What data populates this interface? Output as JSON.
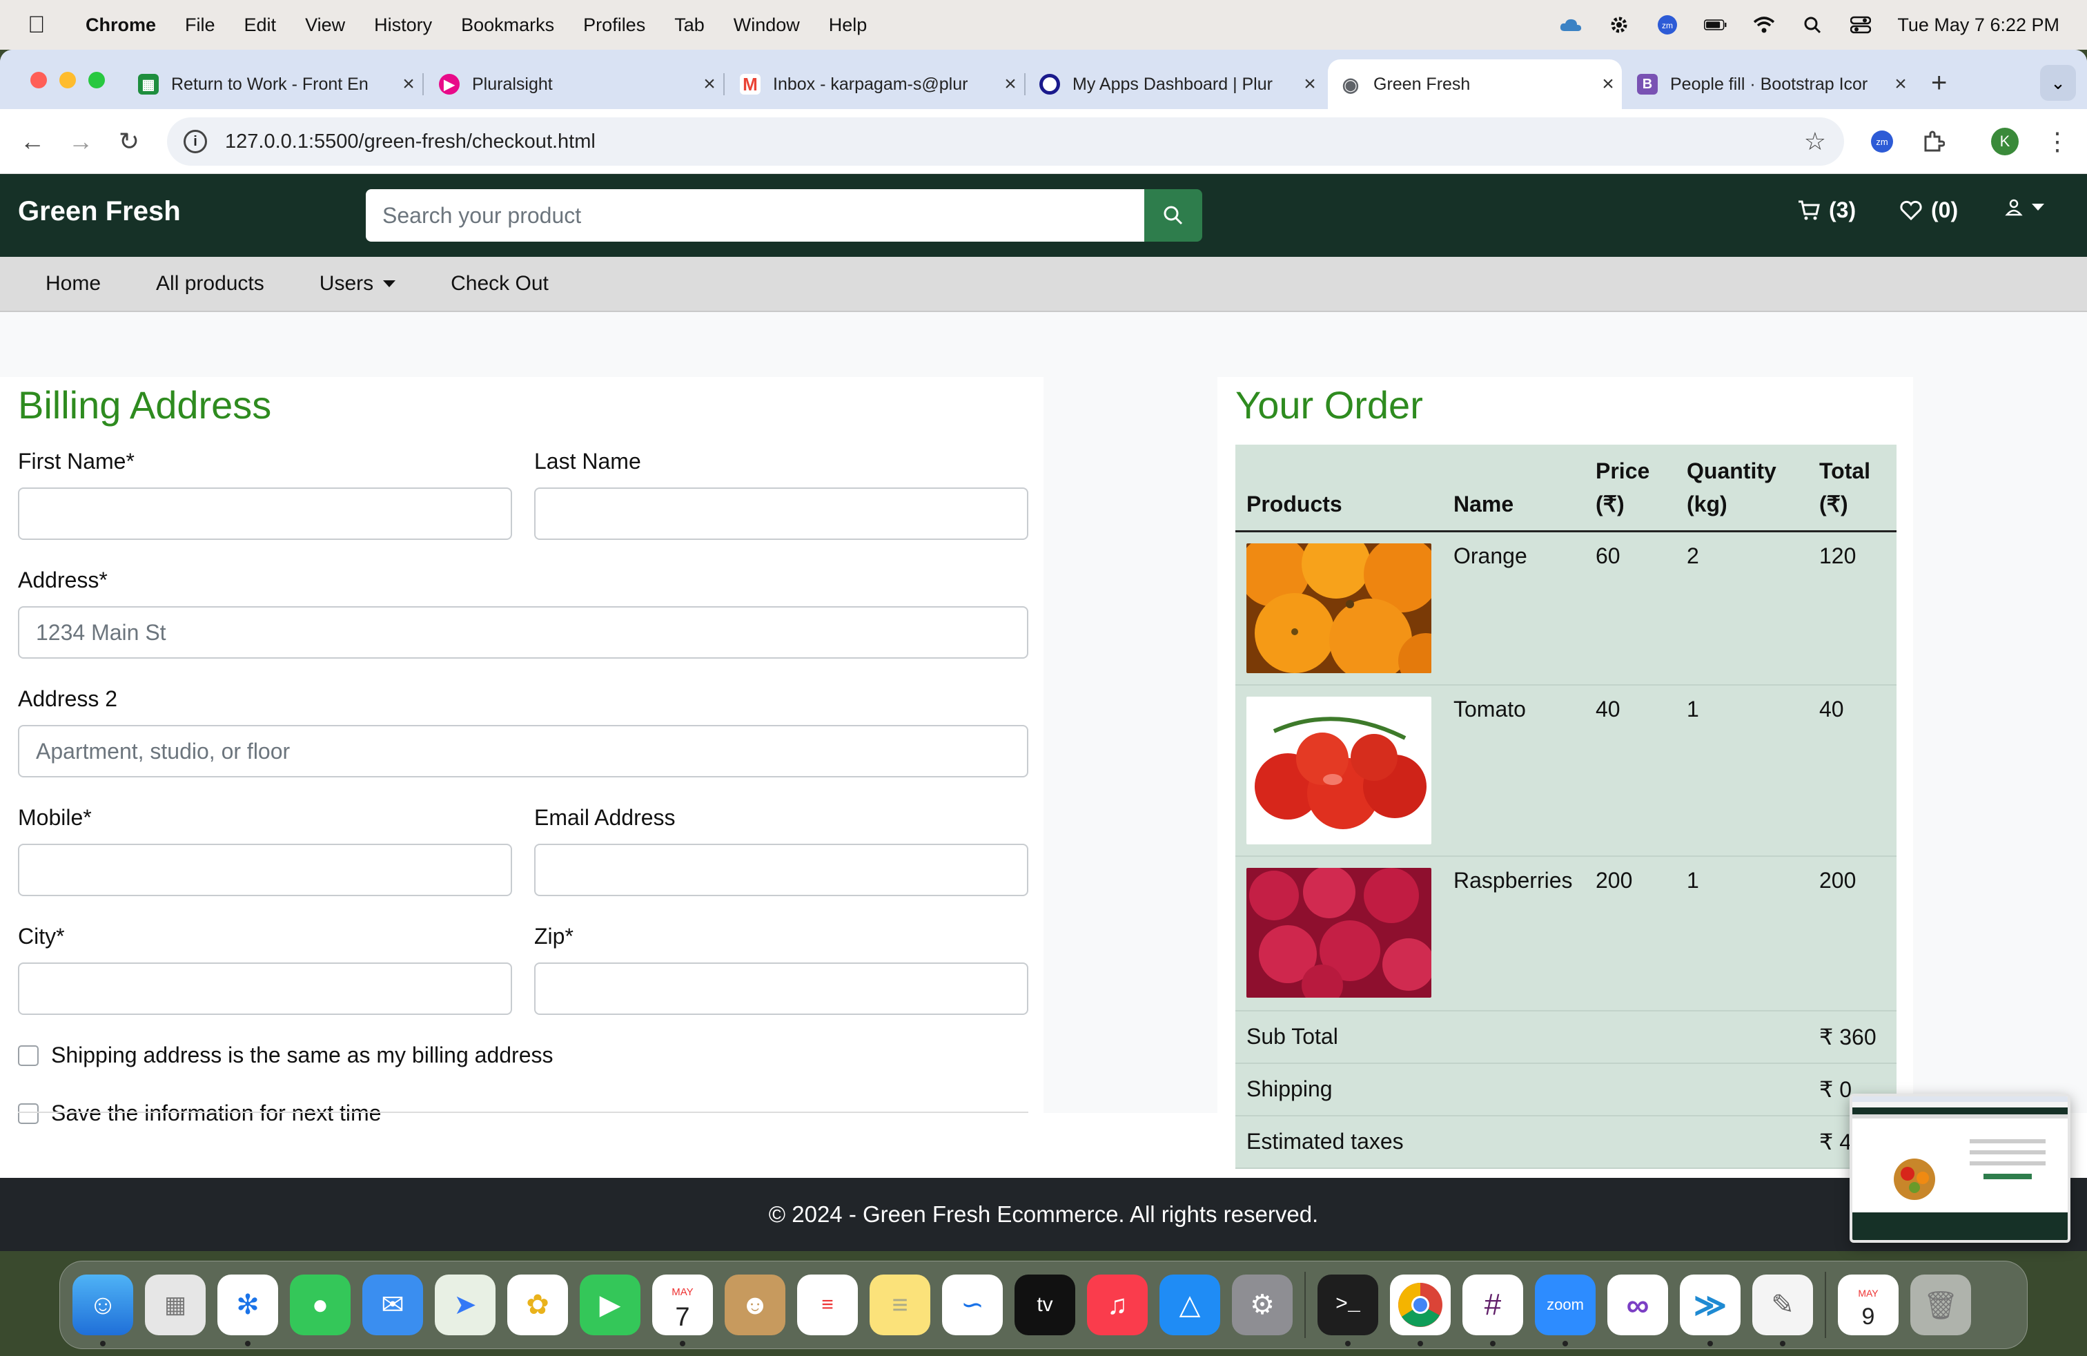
{
  "menubar": {
    "app": "Chrome",
    "items": [
      "File",
      "Edit",
      "View",
      "History",
      "Bookmarks",
      "Profiles",
      "Tab",
      "Window",
      "Help"
    ],
    "clock": "Tue May 7  6:22 PM"
  },
  "browser": {
    "tabs": [
      {
        "label": "Return to Work - Front En",
        "icon": "sheets-icon",
        "color": "#1e8e3e"
      },
      {
        "label": "Pluralsight",
        "icon": "pluralsight-icon",
        "color": "#e80a89"
      },
      {
        "label": "Inbox - karpagam-s@plur",
        "icon": "gmail-icon",
        "color": "#ea4335"
      },
      {
        "label": "My Apps Dashboard | Plur",
        "icon": "okta-icon",
        "color": "#1a1a8c"
      },
      {
        "label": "Green Fresh",
        "icon": "globe-icon",
        "color": "#5f6368"
      },
      {
        "label": "People fill · Bootstrap Icor",
        "icon": "bootstrap-icon",
        "color": "#7952b3"
      }
    ],
    "url": "127.0.0.1:5500/green-fresh/checkout.html",
    "profile_initial": "K"
  },
  "site": {
    "brand": "Green Fresh",
    "search_placeholder": "Search your product",
    "cart_count": "(3)",
    "wishlist_count": "(0)",
    "nav": [
      "Home",
      "All products",
      "Users",
      "Check Out"
    ],
    "billing": {
      "title": "Billing Address",
      "first_name_label": "First Name*",
      "last_name_label": "Last Name",
      "address_label": "Address*",
      "address_placeholder": "1234 Main St",
      "address2_label": "Address 2",
      "address2_placeholder": "Apartment, studio, or floor",
      "mobile_label": "Mobile*",
      "email_label": "Email Address",
      "city_label": "City*",
      "zip_label": "Zip*",
      "same_address_label": "Shipping address is the same as my billing address",
      "save_info_label": "Save the information for next time"
    },
    "order": {
      "title": "Your Order",
      "headers": [
        "Products",
        "Name",
        "Price (₹)",
        "Quantity (kg)",
        "Total (₹)"
      ],
      "items": [
        {
          "name": "Orange",
          "price": "60",
          "qty": "2",
          "total": "120"
        },
        {
          "name": "Tomato",
          "price": "40",
          "qty": "1",
          "total": "40"
        },
        {
          "name": "Raspberries",
          "price": "200",
          "qty": "1",
          "total": "200"
        }
      ],
      "summary": [
        {
          "label": "Sub Total",
          "value": "₹ 360"
        },
        {
          "label": "Shipping",
          "value": "₹ 0"
        },
        {
          "label": "Estimated taxes",
          "value": "₹ 4"
        }
      ]
    },
    "footer": "© 2024 - Green Fresh Ecommerce. All rights reserved."
  },
  "dock": {
    "calendar_month": "MAY",
    "calendar_day": "7",
    "calendar2_day": "9",
    "zoom_label": "zoom",
    "tv_label": "tv"
  },
  "colors": {
    "header": "#163127",
    "accent_green": "#2e8b1f",
    "table_bg": "#d3e3da",
    "footer": "#212529"
  }
}
